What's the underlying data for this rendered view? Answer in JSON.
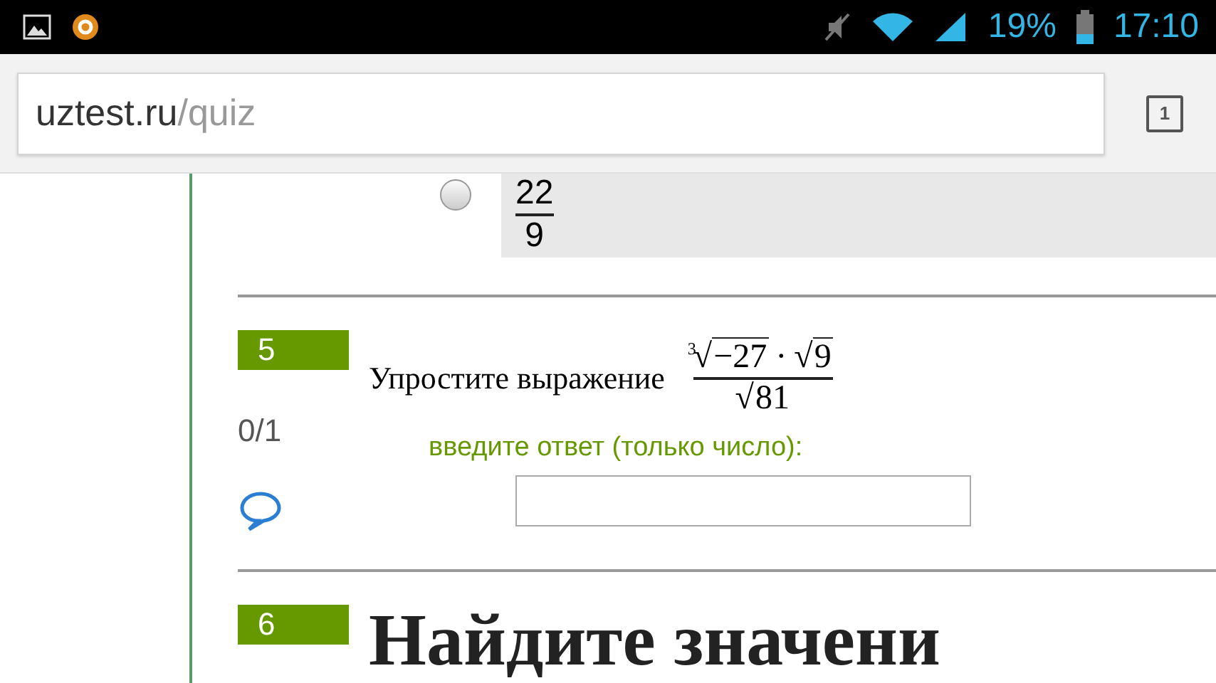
{
  "status_bar": {
    "battery_percent": "19%",
    "time": "17:10"
  },
  "address_bar": {
    "domain": "uztest.ru",
    "path": "/quiz",
    "tab_count": "1"
  },
  "previous_option": {
    "selected": false,
    "numerator": "22",
    "denominator": "9"
  },
  "questions": [
    {
      "number": "5",
      "score": "0/1",
      "prompt": "Упростите выражение",
      "expression": {
        "numerator": [
          {
            "kind": "root",
            "sign": "√",
            "index": "3",
            "radicand": "−27"
          },
          {
            "kind": "op",
            "text": "·"
          },
          {
            "kind": "root",
            "sign": "√",
            "radicand": "9"
          }
        ],
        "denominator": [
          {
            "kind": "root",
            "sign": "√",
            "radicand": "81"
          }
        ]
      },
      "answer_label": "введите ответ (только число):"
    },
    {
      "number": "6",
      "prompt": "Найдите значени"
    }
  ]
}
